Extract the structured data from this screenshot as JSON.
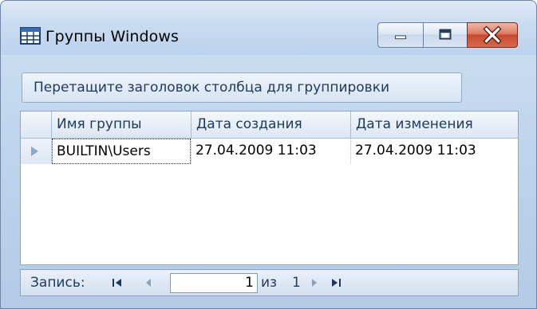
{
  "window": {
    "title": "Группы Windows",
    "icon": "table-icon",
    "controls": {
      "minimize": "minimize-icon",
      "maximize": "maximize-icon",
      "close": "close-icon"
    }
  },
  "group_panel": {
    "hint": "Перетащите заголовок столбца для группировки"
  },
  "grid": {
    "columns": [
      "Имя группы",
      "Дата создания",
      "Дата изменения"
    ],
    "rows": [
      [
        "BUILTIN\\Users",
        "27.04.2009 11:03",
        "27.04.2009 11:03"
      ]
    ],
    "current_row_indicator": "triangle-right-icon"
  },
  "navigator": {
    "label": "Запись:",
    "current": "1",
    "of_label": "из",
    "total": "1",
    "first_icon": "first-record-icon",
    "prev_icon": "prev-record-icon",
    "next_icon": "next-record-icon",
    "last_icon": "last-record-icon"
  },
  "colors": {
    "frame": "#bcd3ec",
    "header_text": "#1e395b",
    "close_button": "#c84a30"
  }
}
